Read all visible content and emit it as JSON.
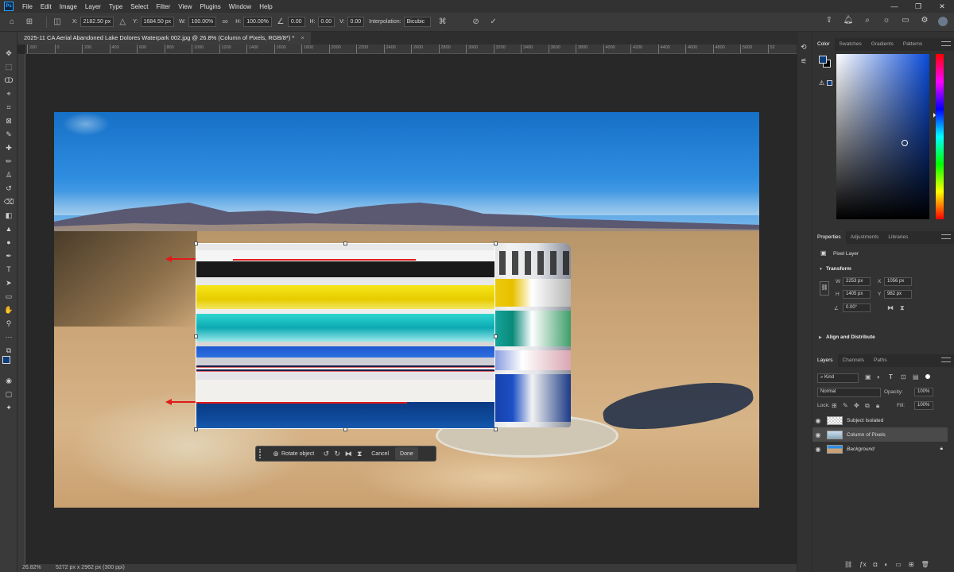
{
  "menu": {
    "app_logo": "Ps",
    "items": [
      "File",
      "Edit",
      "Image",
      "Layer",
      "Type",
      "Select",
      "Filter",
      "View",
      "Plugins",
      "Window",
      "Help"
    ]
  },
  "options_bar": {
    "x_label": "X:",
    "x_value": "2182.50 px",
    "y_label": "Y:",
    "y_value": "1684.50 px",
    "w_label": "W:",
    "w_value": "100.00%",
    "h_label": "H:",
    "h_value": "100.00%",
    "angle_value": "0.00",
    "hskew_label": "H:",
    "hskew_value": "0.00",
    "vskew_label": "V:",
    "vskew_value": "0.00",
    "interp_label": "Interpolation:",
    "interp_value": "Bicubic"
  },
  "document": {
    "tab_title": "2025-11 CA Aerial Abandoned Lake Dolores Waterpark 002.jpg @ 26.8% (Column of Pixels, RGB/8*) *",
    "close": "×"
  },
  "ruler_ticks": [
    "200",
    "0",
    "200",
    "400",
    "600",
    "800",
    "1000",
    "1200",
    "1400",
    "1600",
    "1800",
    "2000",
    "2200",
    "2400",
    "2600",
    "2800",
    "3000",
    "3200",
    "3400",
    "3600",
    "3800",
    "4000",
    "4200",
    "4400",
    "4600",
    "4800",
    "5000",
    "52"
  ],
  "context_bar": {
    "rotate_label": "Rotate object",
    "cancel_label": "Cancel",
    "done_label": "Done"
  },
  "status": {
    "zoom": "26.82%",
    "doc_size": "5272 px x 2962 px (300 ppi)"
  },
  "color_panel": {
    "tabs": [
      "Color",
      "Swatches",
      "Gradients",
      "Patterns"
    ],
    "foreground": "#0d3d7a",
    "background": "#000000"
  },
  "properties_panel": {
    "tabs": [
      "Properties",
      "Adjustments",
      "Libraries"
    ],
    "layer_type": "Pixel Layer",
    "transform_heading": "Transform",
    "w_label": "W",
    "w_value": "2253 px",
    "x_label": "X",
    "x_value": "1056 px",
    "h_label": "H",
    "h_value": "1405 px",
    "y_label": "Y",
    "y_value": "982 px",
    "angle_value": "0.00°",
    "align_heading": "Align and Distribute"
  },
  "layers_panel": {
    "tabs": [
      "Layers",
      "Channels",
      "Paths"
    ],
    "filter_kind": "Kind",
    "blend_mode": "Normal",
    "opacity_label": "Opacity:",
    "opacity_value": "100%",
    "lock_label": "Lock:",
    "fill_label": "Fill:",
    "fill_value": "100%",
    "layers": [
      {
        "name": "Subject Isolated"
      },
      {
        "name": "Column of Pixels"
      },
      {
        "name": "Background"
      }
    ]
  }
}
